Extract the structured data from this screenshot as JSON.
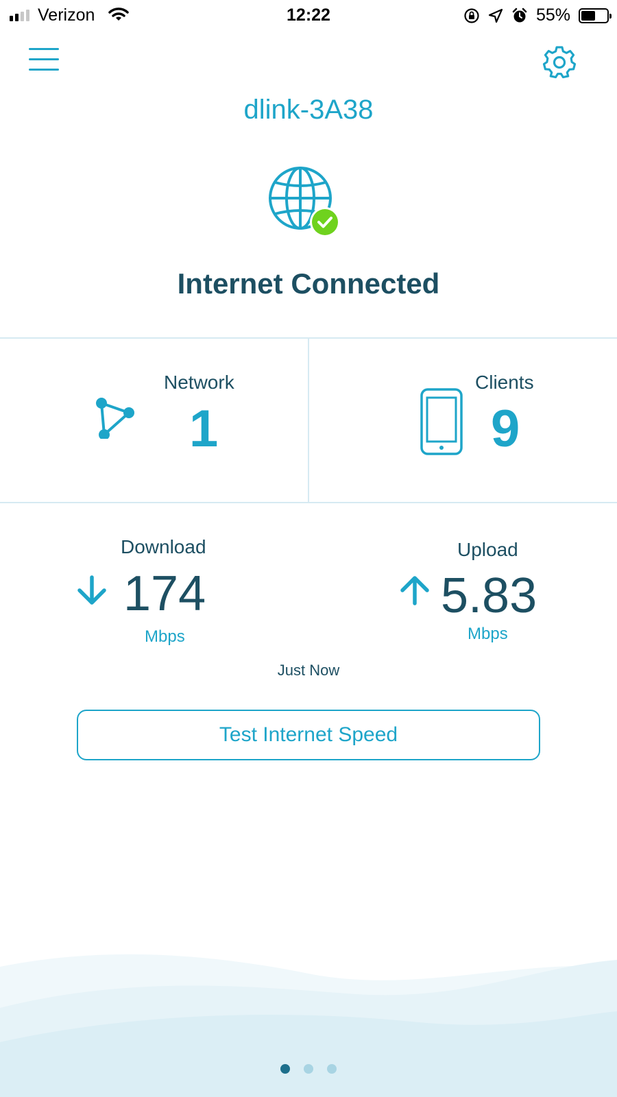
{
  "status_bar": {
    "carrier": "Verizon",
    "time": "12:22",
    "battery": "55%",
    "battery_level": 0.55,
    "icons": [
      "signal-icon",
      "wifi-icon",
      "rotation-lock-icon",
      "location-icon",
      "alarm-icon",
      "battery-icon"
    ]
  },
  "header": {
    "menu_icon": "hamburger-menu-icon",
    "settings_icon": "gear-icon",
    "network_name": "dlink-3A38"
  },
  "connection": {
    "icon": "globe-icon",
    "badge_icon": "check-badge-icon",
    "status": "Internet Connected"
  },
  "network_card": {
    "label": "Network",
    "value": "1",
    "icon": "mesh-network-icon"
  },
  "clients_card": {
    "label": "Clients",
    "value": "9",
    "icon": "phone-icon"
  },
  "speed": {
    "download": {
      "label": "Download",
      "value": "174",
      "unit": "Mbps",
      "icon": "arrow-down-icon"
    },
    "upload": {
      "label": "Upload",
      "value": "5.83",
      "unit": "Mbps",
      "icon": "arrow-up-icon"
    },
    "updated": "Just Now"
  },
  "test_button": {
    "label": "Test Internet Speed"
  },
  "pager": {
    "count": 3,
    "active_index": 0
  },
  "colors": {
    "accent": "#1ea5c9",
    "text_dark": "#1d4f62",
    "success": "#6fd21e",
    "divider": "#d6eaf2",
    "dot_active": "#1d6f8c",
    "dot_inactive": "#a8d4e3"
  }
}
